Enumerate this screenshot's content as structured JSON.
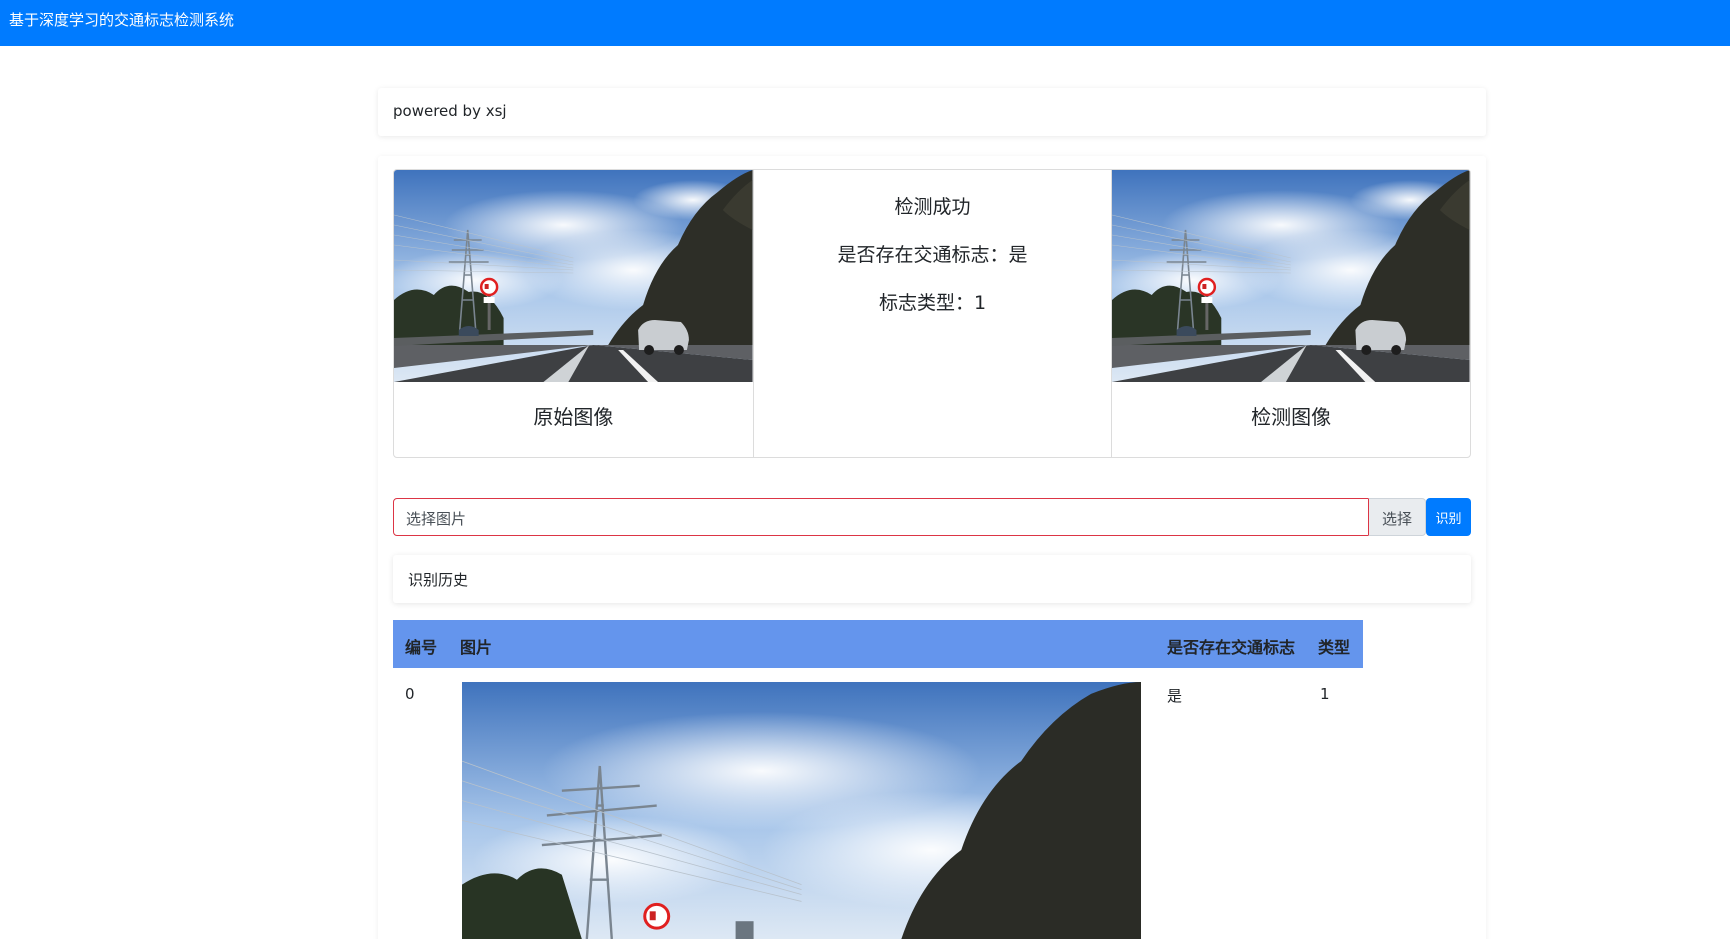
{
  "app": {
    "title": "基于深度学习的交通标志检测系统"
  },
  "header": {
    "text": "powered by xsj"
  },
  "panels": {
    "original_caption": "原始图像",
    "detected_caption": "检测图像",
    "status": "检测成功",
    "has_sign": "是否存在交通标志：是",
    "sign_type": "标志类型：1"
  },
  "upload": {
    "placeholder": "选择图片",
    "browse_label": "选择",
    "identify_label": "识别"
  },
  "history": {
    "title": "识别历史",
    "columns": [
      "编号",
      "图片",
      "是否存在交通标志",
      "类型"
    ],
    "rows": [
      {
        "id": "0",
        "has_sign": "是",
        "type": "1"
      }
    ]
  },
  "colors": {
    "topbar": "#007bff",
    "table_header": "#6495ed",
    "input_border": "#dc3545",
    "primary_button": "#007bff"
  }
}
